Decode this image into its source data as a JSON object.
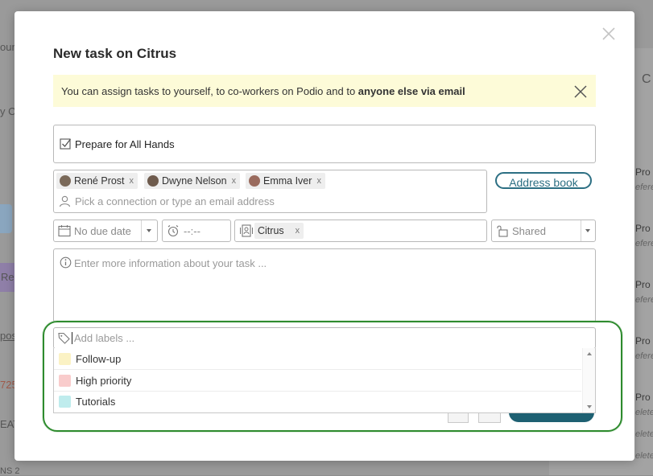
{
  "background": {
    "fragments": [
      "our",
      "y Cl",
      "Re",
      "pos",
      "725",
      "EAT",
      "NS 2",
      "C"
    ],
    "right_items": [
      "Pro",
      "Pro",
      "Pro",
      "Pro",
      "Pro",
      "Pro"
    ],
    "right_subs": [
      "efere",
      "efere",
      "efere",
      "efere",
      "elete",
      "elete",
      "elete"
    ]
  },
  "modal": {
    "title": "New task on Citrus",
    "notice": {
      "text": "You can assign tasks to yourself, to co-workers on Podio and to ",
      "bold": "anyone else via email"
    },
    "task_title": "Prepare for All Hands",
    "assignees": [
      {
        "name": "René Prost",
        "remove": "x"
      },
      {
        "name": "Dwyne Nelson",
        "remove": "x"
      },
      {
        "name": "Emma Iver",
        "remove": "x"
      }
    ],
    "assign_placeholder": "Pick a connection or type an email address",
    "address_book_label": "Address book",
    "due_date": "No due date",
    "due_time": "--:--",
    "workspace": {
      "name": "Citrus",
      "remove": "x"
    },
    "sharing": "Shared",
    "description_placeholder": "Enter more information about your task ...",
    "labels_placeholder": "Add labels ...",
    "labels": [
      {
        "name": "Follow-up",
        "color": "#fbf2c4"
      },
      {
        "name": "High priority",
        "color": "#f9cccc"
      },
      {
        "name": "Tutorials",
        "color": "#bfeced"
      }
    ]
  },
  "colors": {
    "accent": "#2c6f83",
    "highlight": "#2e8b2e",
    "notice_bg": "#fdfbd8"
  }
}
